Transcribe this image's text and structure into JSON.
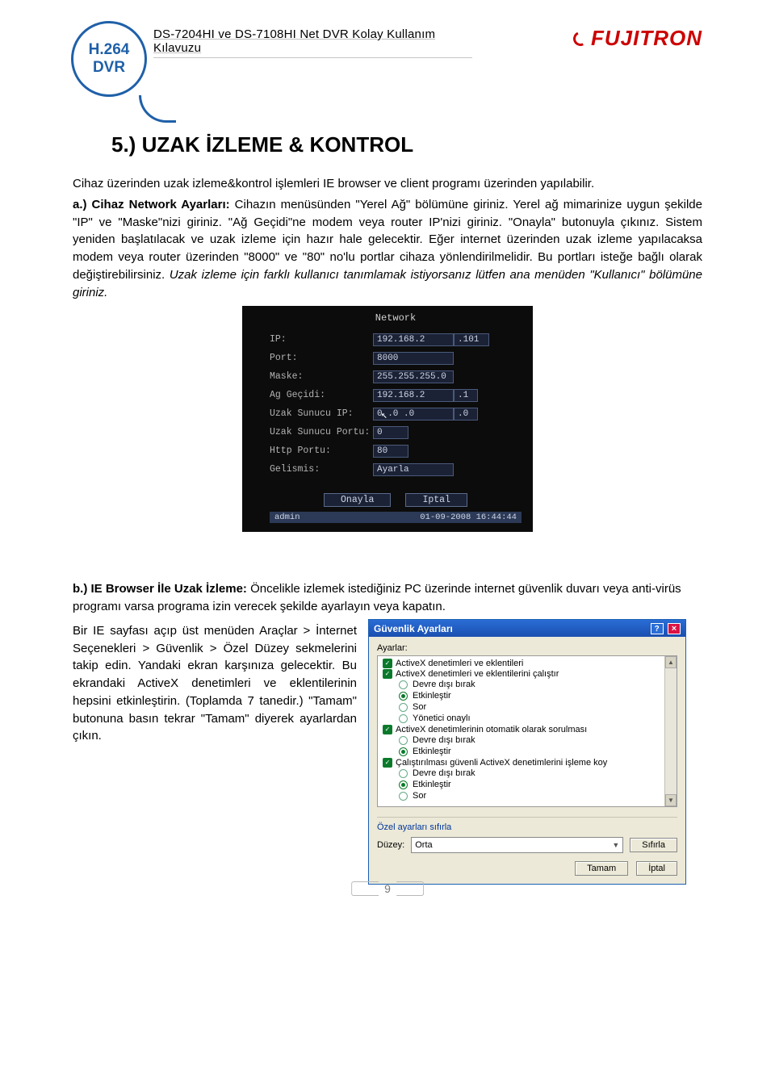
{
  "badge": {
    "line1": "H.264",
    "line2": "DVR"
  },
  "doc_title": "DS-7204HI ve DS-7108HI Net DVR  Kolay Kullanım Kılavuzu",
  "brand": "FUJITRON",
  "section_title": "5.) UZAK İZLEME & KONTROL",
  "para1": "Cihaz üzerinden uzak izleme&kontrol işlemleri IE browser ve client programı üzerinden yapılabilir.",
  "para2_lead": "a.)   Cihaz Network Ayarları: ",
  "para2_body": "Cihazın menüsünden \"Yerel Ağ\" bölümüne giriniz. Yerel ağ mimarinize uygun şekilde \"IP\" ve \"Maske\"nizi giriniz. \"Ağ Geçidi\"ne modem veya router IP'nizi giriniz. \"Onayla\" butonuyla çıkınız. Sistem yeniden başlatılacak ve uzak izleme için hazır hale gelecektir. Eğer internet üzerinden uzak izleme yapılacaksa modem veya router üzerinden \"8000\" ve \"80\" no'lu portlar cihaza yönlendirilmelidir. Bu portları isteğe bağlı olarak değiştirebilirsiniz. ",
  "para2_tail_italic": "Uzak izleme için farklı kullanıcı tanımlamak istiyorsanız lütfen ana menüden \"Kullanıcı\" bölümüne giriniz.",
  "network": {
    "title": "Network",
    "rows": {
      "ip_lbl": "IP:",
      "ip_a": "192.168.2",
      "ip_b": ".101",
      "port_lbl": "Port:",
      "port_v": "8000",
      "mask_lbl": "Maske:",
      "mask_v": "255.255.255.0",
      "gw_lbl": "Ag Geçidi:",
      "gw_a": "192.168.2",
      "gw_b": ".1",
      "rsip_lbl": "Uzak Sunucu IP:",
      "rsip_a": "0 .0 .0",
      "rsip_b": ".0",
      "rsport_lbl": "Uzak Sunucu Portu:",
      "rsport_v": "0",
      "http_lbl": "Http Portu:",
      "http_v": "80",
      "adv_lbl": "Gelismis:",
      "adv_v": "Ayarla"
    },
    "btn_ok": "Onayla",
    "btn_cancel": "Iptal",
    "status_user": "admin",
    "status_time": "01-09-2008 16:44:44"
  },
  "para3_lead": "b.)       IE Browser İle Uzak İzleme: ",
  "para3_body": "Öncelikle izlemek istediğiniz PC üzerinde internet güvenlik duvarı veya anti-virüs programı varsa programa izin verecek şekilde ayarlayın veya kapatın.",
  "col_left": "Bir IE sayfası açıp üst menüden Araçlar > İnternet Seçenekleri > Güvenlik > Özel Düzey sekmelerini takip edin. Yandaki ekran karşınıza gelecektir. Bu ekrandaki ActiveX denetimleri ve eklentilerinin hepsini etkinleştirin. (Toplamda 7 tanedir.) \"Tamam\" butonuna basın tekrar \"Tamam\" diyerek ayarlardan çıkın.",
  "dialog": {
    "title": "Güvenlik Ayarları",
    "list_label": "Ayarlar:",
    "groups": [
      {
        "name": "ActiveX denetimleri ve eklentileri",
        "opts": []
      },
      {
        "name": "ActiveX denetimleri ve eklentilerini çalıştır",
        "opts": [
          "Devre dışı bırak",
          "Etkinleştir",
          "Sor",
          "Yönetici onaylı"
        ],
        "on": 1
      },
      {
        "name": "ActiveX denetimlerinin otomatik olarak sorulması",
        "opts": [
          "Devre dışı bırak",
          "Etkinleştir"
        ],
        "on": 1
      },
      {
        "name": "Çalıştırılması güvenli ActiveX denetimlerini işleme koy",
        "opts": [
          "Devre dışı bırak",
          "Etkinleştir",
          "Sor"
        ],
        "on": 1
      }
    ],
    "reset_label": "Özel ayarları sıfırla",
    "level_label": "Düzey:",
    "level_value": "Orta",
    "reset_btn": "Sıfırla",
    "ok": "Tamam",
    "cancel": "İptal"
  },
  "page_number": "9"
}
